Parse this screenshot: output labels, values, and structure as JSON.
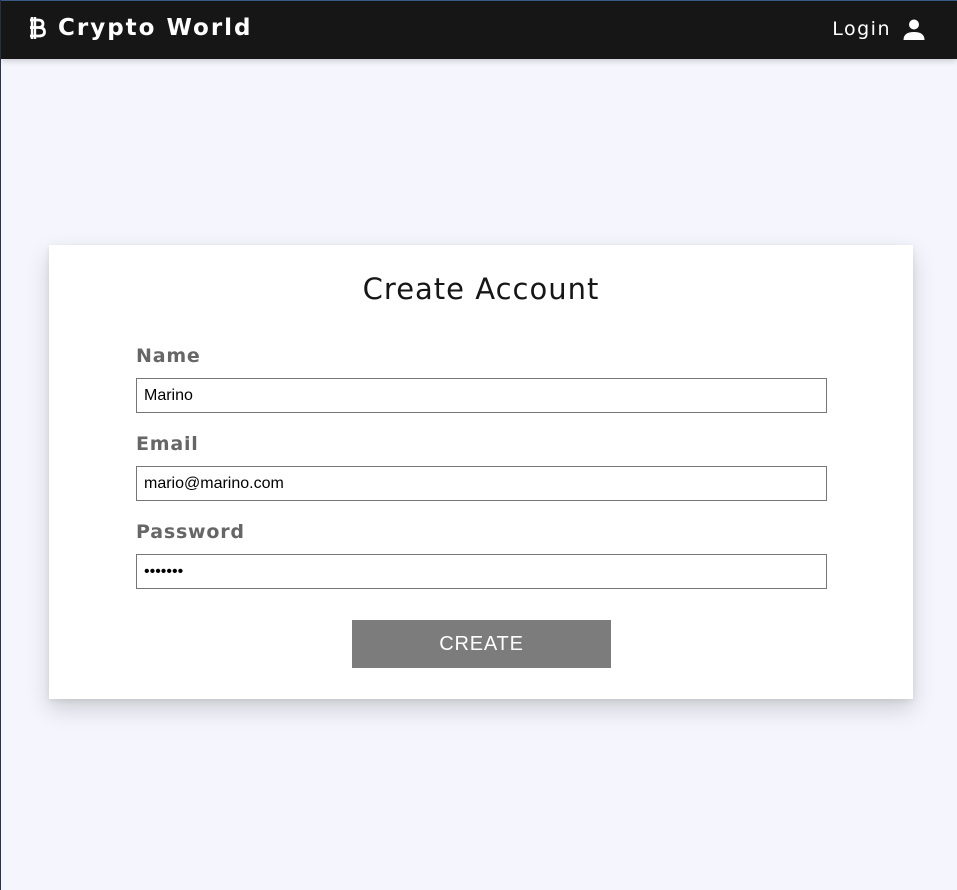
{
  "header": {
    "brand_icon": "bitcoin-icon",
    "title": "Crypto World",
    "login_label": "Login",
    "login_icon": "user-icon"
  },
  "form": {
    "title": "Create Account",
    "fields": {
      "name": {
        "label": "Name",
        "value": "Marino"
      },
      "email": {
        "label": "Email",
        "value": "mario@marino.com"
      },
      "password": {
        "label": "Password",
        "value": "•••••••"
      }
    },
    "submit_label": "CREATE"
  },
  "colors": {
    "navbar_bg": "#161616",
    "page_bg": "#f5f6fd",
    "button_bg": "#7c7c7c",
    "label_color": "#666666"
  }
}
